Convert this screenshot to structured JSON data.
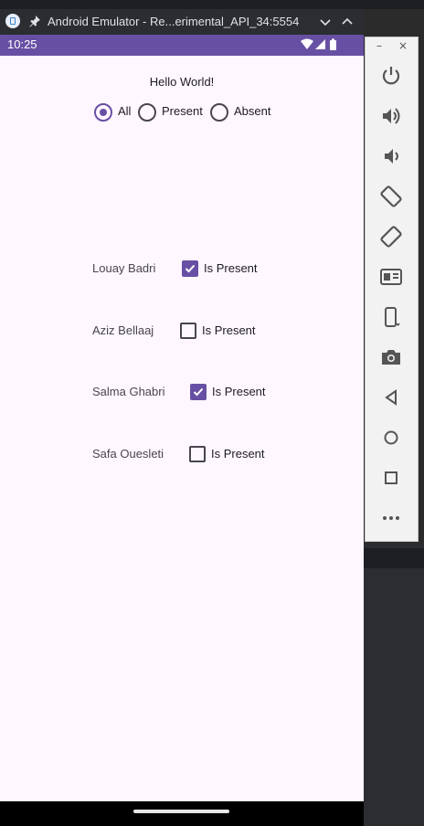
{
  "window": {
    "title": "Android Emulator - Re...erimental_API_34:5554"
  },
  "status_bar": {
    "time": "10:25"
  },
  "screen": {
    "greeting": "Hello World!",
    "filter": {
      "selected": "All",
      "options": [
        "All",
        "Present",
        "Absent"
      ]
    },
    "students": [
      {
        "name": "Louay Badri",
        "label": "Is Present",
        "present": true
      },
      {
        "name": "Aziz Bellaaj",
        "label": "Is Present",
        "present": false
      },
      {
        "name": "Salma Ghabri",
        "label": "Is Present",
        "present": true
      },
      {
        "name": "Safa Ouesleti",
        "label": "Is Present",
        "present": false
      }
    ]
  },
  "toolbar": {
    "minimize": "–",
    "close": "×",
    "buttons": [
      "power-icon",
      "volume-up-icon",
      "volume-down-icon",
      "rotate-left-icon",
      "rotate-right-icon",
      "screenshot-icon",
      "fold-icon",
      "camera-icon",
      "back-icon",
      "home-icon",
      "overview-icon",
      "more-icon"
    ]
  },
  "colors": {
    "accent": "#6750a4",
    "screen_bg": "#fef7ff",
    "status_bar": "#6750a4"
  }
}
